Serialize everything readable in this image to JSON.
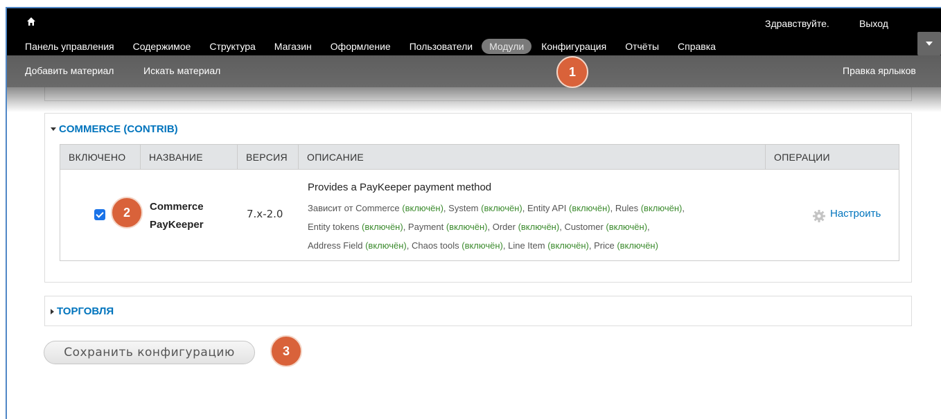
{
  "toolbar": {
    "menu": [
      {
        "label": "Панель управления"
      },
      {
        "label": "Содержимое"
      },
      {
        "label": "Структура"
      },
      {
        "label": "Магазин"
      },
      {
        "label": "Оформление"
      },
      {
        "label": "Пользователи"
      },
      {
        "label": "Модули",
        "active": true
      },
      {
        "label": "Конфигурация"
      },
      {
        "label": "Отчёты"
      },
      {
        "label": "Справка"
      }
    ],
    "greeting": "Здравствуйте.",
    "logout": "Выход"
  },
  "shortcuts": {
    "add_content": "Добавить материал",
    "search_content": "Искать материал",
    "edit_shortcuts": "Правка ярлыков"
  },
  "badges": [
    "1",
    "2",
    "3"
  ],
  "commerce_contrib": {
    "title": "COMMERCE (CONTRIB)",
    "columns": [
      "ВКЛЮЧЕНО",
      "НАЗВАНИЕ",
      "ВЕРСИЯ",
      "ОПИСАНИЕ",
      "ОПЕРАЦИИ"
    ],
    "row": {
      "enabled": true,
      "name_line1": "Commerce",
      "name_line2": "PayKeeper",
      "version": "7.x-2.0",
      "description": "Provides a PayKeeper payment method",
      "depends_prefix": "Зависит от",
      "enabled_tag": "(включён)",
      "dependencies": [
        "Commerce",
        "System",
        "Entity API",
        "Rules",
        "Entity tokens",
        "Payment",
        "Order",
        "Customer",
        "Address Field",
        "Chaos tools",
        "Line Item",
        "Price"
      ],
      "configure": "Настроить"
    }
  },
  "trade": {
    "title": "ТОРГОВЛЯ"
  },
  "save_button": "Сохранить конфигурацию"
}
